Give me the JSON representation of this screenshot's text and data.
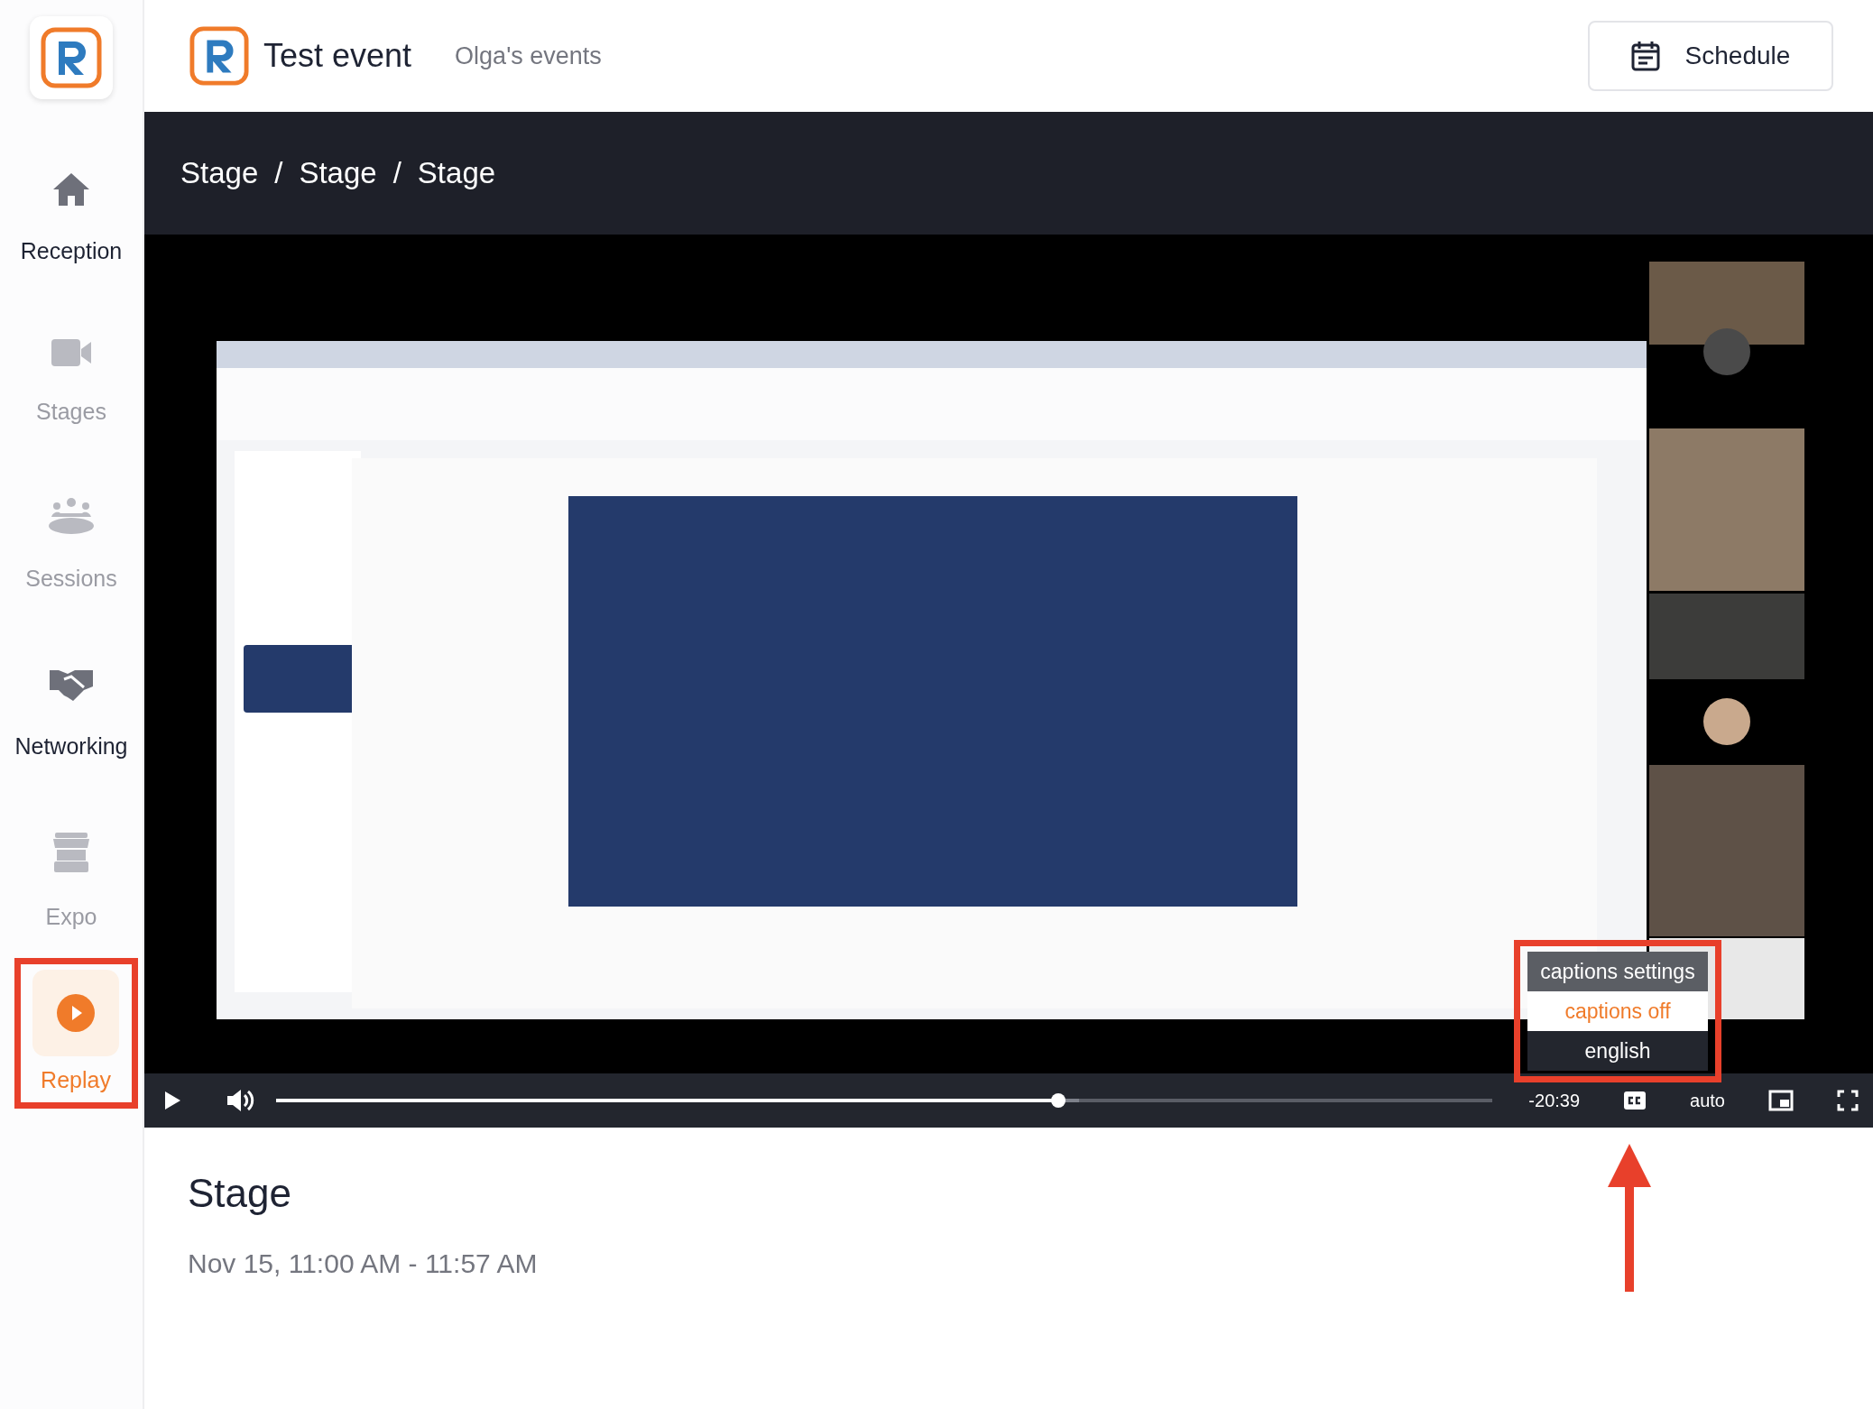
{
  "sidebar": {
    "items": [
      {
        "label": "Reception",
        "kind": "home",
        "highlighted": true,
        "selected": false
      },
      {
        "label": "Stages",
        "kind": "camera",
        "highlighted": false,
        "selected": false
      },
      {
        "label": "Sessions",
        "kind": "people",
        "highlighted": false,
        "selected": false
      },
      {
        "label": "Networking",
        "kind": "handshake",
        "highlighted": true,
        "selected": false
      },
      {
        "label": "Expo",
        "kind": "booth",
        "highlighted": false,
        "selected": false
      },
      {
        "label": "Replay",
        "kind": "replay",
        "highlighted": false,
        "selected": true
      }
    ]
  },
  "header": {
    "title": "Test event",
    "organizer": "Olga's events",
    "schedule_button": "Schedule"
  },
  "breadcrumb": [
    "Stage",
    "/",
    "Stage",
    "/",
    "Stage"
  ],
  "video": {
    "kind": "picture"
  },
  "player": {
    "level": 0.643,
    "time": "-20:39",
    "quality": "auto",
    "captions_menu": {
      "title": "captions settings",
      "options": [
        {
          "label": "captions off",
          "selected": true
        },
        {
          "label": "english",
          "selected": false
        }
      ]
    }
  },
  "session": {
    "title": "Stage",
    "time": "Nov 15, 11:00 AM - 11:57 AM"
  }
}
